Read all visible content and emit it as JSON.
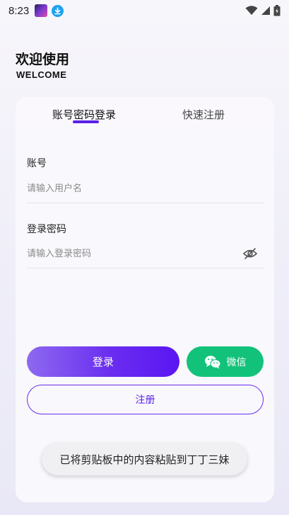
{
  "status_bar": {
    "time": "8:23",
    "app_icon": "app-thumbnail-icon",
    "download_icon": "download-icon",
    "wifi_icon": "wifi-icon",
    "signal_icon": "signal-icon",
    "battery_icon": "battery-icon"
  },
  "header": {
    "title": "欢迎使用",
    "subtitle": "WELCOME"
  },
  "tabs": [
    {
      "label": "账号密码登录",
      "active": true
    },
    {
      "label": "快速注册",
      "active": false
    }
  ],
  "form": {
    "account_label": "账号",
    "account_placeholder": "请输入用户名",
    "password_label": "登录密码",
    "password_placeholder": "请输入登录密码"
  },
  "buttons": {
    "login": "登录",
    "wechat": "微信",
    "register": "注册"
  },
  "toast": "已将剪贴板中的内容粘贴到丁丁三妹",
  "colors": {
    "accent": "#5a22e6",
    "wechat": "#12c27a"
  }
}
